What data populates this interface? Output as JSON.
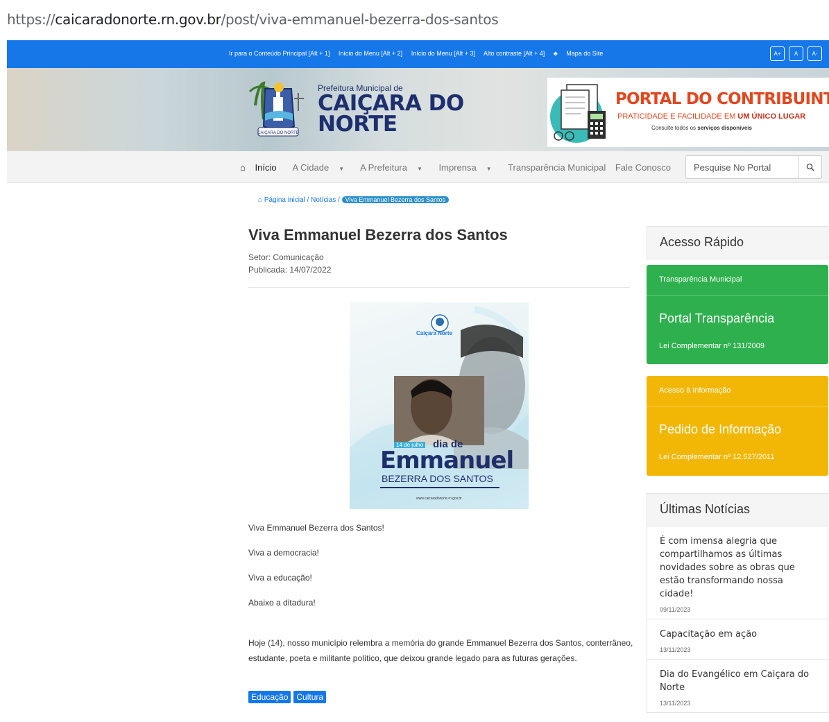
{
  "browser": {
    "url_prefix": "https://",
    "url_host": "caicaradonorte.rn.gov.br",
    "url_path": "/post/viva-emmanuel-bezerra-dos-santos"
  },
  "accessibility": {
    "links": [
      "Ir para o Conteúdo Principal [Alt + 1]",
      "Início do Menu [Alt + 2]",
      "Início do Menu [Alt + 3]",
      "Alto contraste [Alt + 4]",
      "Mapa do Site"
    ],
    "font_buttons": [
      "A+",
      "A",
      "A-"
    ]
  },
  "header": {
    "prefeitura": "Prefeitura Municipal de",
    "city_line1": "CAIÇARA DO",
    "city_line2": "NORTE",
    "portal_title": "PORTAL DO CONTRIBUINTE",
    "portal_sub_1": "PRATICIDADE E FACILIDADE EM ",
    "portal_sub_2": "UM ÚNICO LUGAR",
    "portal_desc_1": "Consulte todos os ",
    "portal_desc_2": "serviços disponíveis"
  },
  "nav": {
    "home": "Início",
    "items": [
      "A Cidade",
      "A Prefeitura",
      "Imprensa",
      "Transparência Municipal",
      "Fale Conosco"
    ],
    "search_placeholder": "Pesquise No Portal"
  },
  "breadcrumb": {
    "home": "Página inicial",
    "section": "Notícias",
    "current": "Viva Emmanuel Bezerra dos Santos"
  },
  "article": {
    "title": "Viva Emmanuel Bezerra dos Santos",
    "sector": "Setor: Comunicação",
    "published": "Publicada: 14/07/2022",
    "paragraphs": [
      "Viva Emmanuel Bezerra dos Santos!",
      "Viva a democracia!",
      "Viva a educação!",
      "Abaixo a ditadura!"
    ],
    "long_paragraph": "Hoje (14), nosso município relembra a memória do grande Emmanuel Bezerra dos Santos, conterrâneo, estudante, poeta e militante político, que deixou grande legado para as futuras gerações.",
    "tags": [
      "Educação",
      "Cultura"
    ],
    "image": {
      "date_label": "14 de julho",
      "dia_de": "dia de",
      "name": "Emmanuel",
      "surname": "BEZERRA DOS SANTOS",
      "logo_text": "Caiçara Norte",
      "site": "www.caicaradonorte.rn.gov.br"
    }
  },
  "sidebar": {
    "quick_title": "Acesso Rápido",
    "green_card": {
      "top": "Transparência Municipal",
      "big": "Portal Transparência",
      "law": "Lei Complementar nº 131/2009"
    },
    "yellow_card": {
      "top": "Acesso à Informação",
      "big": "Pedido de Informação",
      "law": "Lei Complementar nº 12.527/2011"
    },
    "news_title": "Últimas Notícias",
    "news": [
      {
        "title": "É com imensa alegria que compartilhamos as últimas novidades sobre as obras que estão transformando nossa cidade!",
        "date": "09/11/2023"
      },
      {
        "title": "Capacitação em ação",
        "date": "13/11/2023"
      },
      {
        "title": "Dia do Evangélico em Caiçara do Norte",
        "date": "13/11/2023"
      }
    ]
  },
  "colors": {
    "blue": "#1677e8",
    "green": "#2eb04e",
    "yellow": "#f2b705",
    "portal_orange": "#e2471f"
  }
}
